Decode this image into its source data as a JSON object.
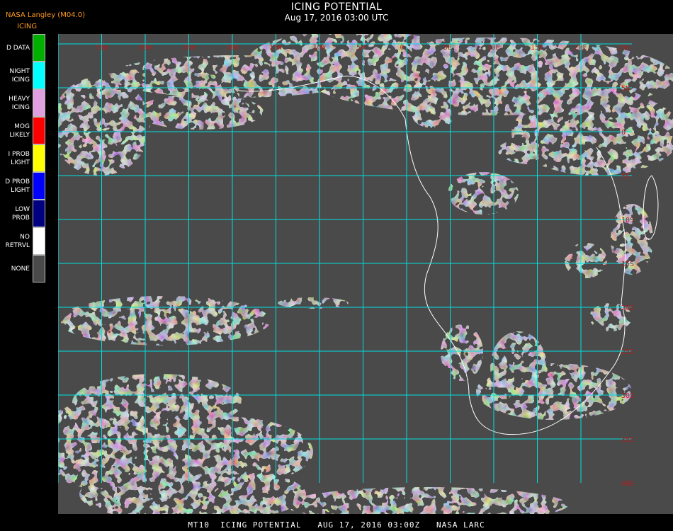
{
  "header": {
    "title": "ICING POTENTIAL",
    "subtitle": "Aug 17, 2016 03:00 UTC",
    "producer": "NASA Langley (M04.0)",
    "product": "ICING"
  },
  "legend": [
    {
      "label": "D DATA",
      "color": "#00b000"
    },
    {
      "label": "NIGHT\nICING",
      "color": "#00ffff"
    },
    {
      "label": "HEAVY\nICING",
      "color": "#e0a0e0"
    },
    {
      "label": "MOG\nLIKELY",
      "color": "#ff0000"
    },
    {
      "label": "I PROB\nLIGHT",
      "color": "#ffff00"
    },
    {
      "label": "D PROB\nLIGHT",
      "color": "#0000ff"
    },
    {
      "label": "LOW\nPROB",
      "color": "#000080"
    },
    {
      "label": "NO\nRETRVL",
      "color": "#ffffff"
    },
    {
      "label": "NONE",
      "color": "#4a4a4a"
    }
  ],
  "map": {
    "background_color": "#4a4a4a",
    "grid_color": "#00e0e0",
    "cloud_color": "#ffffff",
    "icing_color": "#00ffff",
    "coast_color": "#ffffff",
    "lat_labels": [
      "5N",
      "0",
      "5S",
      "10S",
      "15S",
      "20S",
      "25S",
      "30S",
      "35S",
      "40S"
    ],
    "lon_labels": [
      "35W",
      "30W",
      "25W",
      "20W",
      "15W",
      "10W",
      "5W",
      "0",
      "5E",
      "10E",
      "15E",
      "20E",
      "25E"
    ]
  },
  "footer": {
    "text": "MT10  ICING POTENTIAL   AUG 17, 2016 03:00Z   NASA LARC"
  }
}
